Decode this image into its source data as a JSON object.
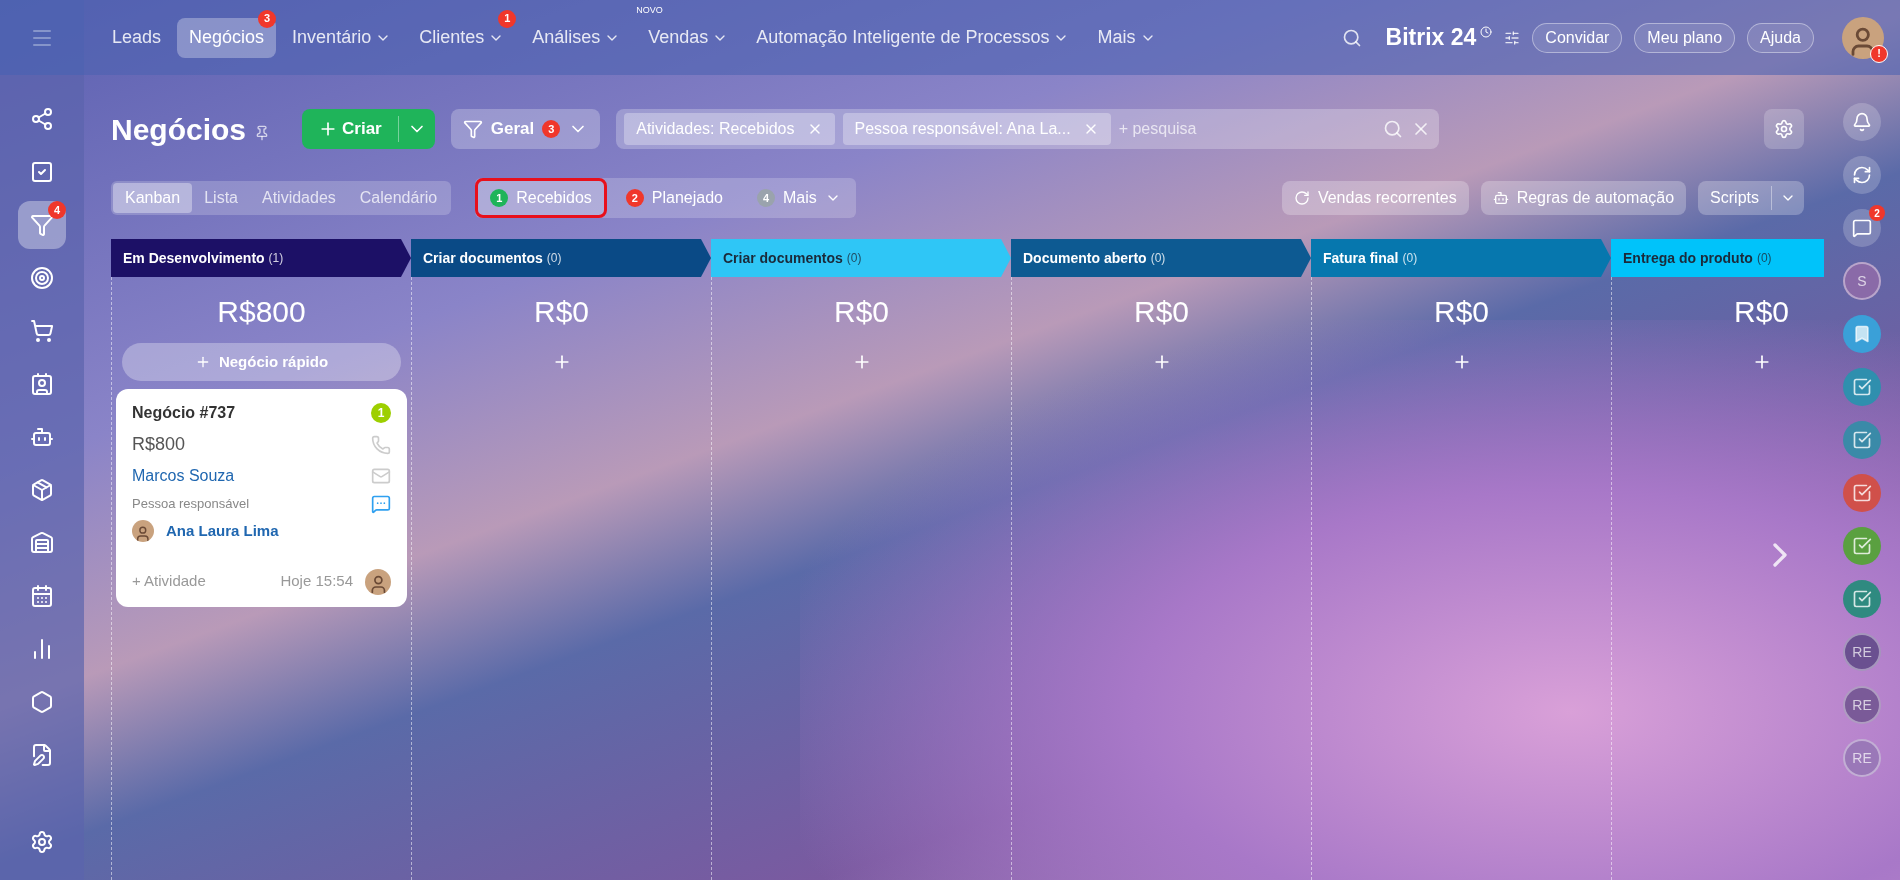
{
  "top_nav": {
    "items": [
      {
        "label": "Leads",
        "selected": false,
        "menu": false
      },
      {
        "label": "Negócios",
        "selected": true,
        "menu": false,
        "badge": "3"
      },
      {
        "label": "Inventário",
        "selected": false,
        "menu": true
      },
      {
        "label": "Clientes",
        "selected": false,
        "menu": true,
        "badge": "1"
      },
      {
        "label": "Análises",
        "selected": false,
        "menu": true
      },
      {
        "label": "Vendas",
        "selected": false,
        "menu": true,
        "tag": "NOVO"
      },
      {
        "label": "Automação Inteligente de Processos",
        "selected": false,
        "menu": true
      },
      {
        "label": "Mais",
        "selected": false,
        "menu": true
      }
    ],
    "logo": "Bitrix",
    "logo_number": "24",
    "buttons": [
      "Convidar",
      "Meu plano",
      "Ajuda"
    ],
    "avatar_alert": "!"
  },
  "left_sidebar": [
    {
      "kind": "share",
      "selected": false
    },
    {
      "kind": "task",
      "selected": false
    },
    {
      "kind": "funnel",
      "selected": true,
      "badge": "4"
    },
    {
      "kind": "target",
      "selected": false
    },
    {
      "kind": "cart",
      "selected": false
    },
    {
      "kind": "contact",
      "selected": false
    },
    {
      "kind": "robot",
      "selected": false
    },
    {
      "kind": "box",
      "selected": false
    },
    {
      "kind": "warehouse",
      "selected": false
    },
    {
      "kind": "calendar",
      "selected": false
    },
    {
      "kind": "chart",
      "selected": false
    },
    {
      "kind": "hexagon",
      "selected": false
    },
    {
      "kind": "document",
      "selected": false
    },
    {
      "kind": "settings",
      "selected": false
    }
  ],
  "page": {
    "title": "Negócios",
    "create_button": "Criar",
    "filter_preset": {
      "label": "Geral",
      "badge": "3"
    },
    "filter_chips": [
      "Atividades: Recebidos",
      "Pessoa responsável: Ana La..."
    ],
    "search": {
      "placeholder": "+ pesquisa"
    }
  },
  "view_tabs": [
    {
      "label": "Kanban",
      "selected": true
    },
    {
      "label": "Lista",
      "selected": false
    },
    {
      "label": "Atividades",
      "selected": false
    },
    {
      "label": "Calendário",
      "selected": false
    }
  ],
  "counters": [
    {
      "count": "1",
      "label": "Recebidos",
      "color": "#1fb45a",
      "selected": true,
      "menu": false
    },
    {
      "count": "2",
      "label": "Planejado",
      "color": "#f0372b",
      "selected": false,
      "menu": false
    },
    {
      "count": "4",
      "label": "Mais",
      "color": "#9aa3ad",
      "selected": false,
      "menu": true
    }
  ],
  "toolbar_buttons": [
    {
      "kind": "recurring",
      "label": "Vendas recorrentes"
    },
    {
      "kind": "robot",
      "label": "Regras de automação"
    },
    {
      "kind": "split",
      "label": "Scripts"
    }
  ],
  "columns": [
    {
      "title": "Em Desenvolvimento",
      "count": "(1)",
      "color": "#1c1066",
      "dark_text": false,
      "total": "R$800",
      "quick_add": "Negócio rápido"
    },
    {
      "title": "Criar documentos",
      "count": "(0)",
      "color": "#0a4a86",
      "dark_text": false,
      "total": "R$0"
    },
    {
      "title": "Criar documentos",
      "count": "(0)",
      "color": "#2fc6f6",
      "dark_text": true,
      "total": "R$0"
    },
    {
      "title": "Documento aberto",
      "count": "(0)",
      "color": "#0d5a92",
      "dark_text": false,
      "total": "R$0"
    },
    {
      "title": "Fatura final",
      "count": "(0)",
      "color": "#0677ae",
      "dark_text": false,
      "total": "R$0"
    },
    {
      "title": "Entrega do produto",
      "count": "(0)",
      "color": "#00c3fa",
      "dark_text": true,
      "total": "R$0"
    }
  ],
  "card": {
    "title": "Negócio #737",
    "counter": "1",
    "amount": "R$800",
    "contact": "Marcos Souza",
    "responsible_label": "Pessoa responsável",
    "responsible": "Ana Laura Lima",
    "activity": "+ Atividade",
    "time": "Hoje 15:54"
  },
  "right_panel": [
    {
      "kind": "bell"
    },
    {
      "kind": "sync"
    },
    {
      "kind": "chat",
      "badge": "2"
    },
    {
      "kind": "text",
      "label": "S",
      "color": "#8a6aa8"
    },
    {
      "kind": "bookmark",
      "color": "#3aa0d8"
    },
    {
      "kind": "task",
      "color": "#2f8fae"
    },
    {
      "kind": "task",
      "color": "#3a8aa8"
    },
    {
      "kind": "task",
      "color": "#d0504a"
    },
    {
      "kind": "task",
      "color": "#5aa040"
    },
    {
      "kind": "task",
      "color": "#2f8a80"
    },
    {
      "kind": "text",
      "label": "RE",
      "color": "#6a5090"
    },
    {
      "kind": "text",
      "label": "RE",
      "color": "#7a5a98"
    },
    {
      "kind": "text",
      "label": "RE",
      "color": "#9a78b8"
    }
  ]
}
